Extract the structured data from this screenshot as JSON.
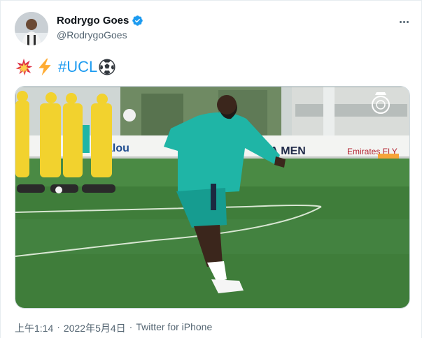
{
  "author": {
    "display_name": "Rodrygo Goes",
    "handle": "@RodrygoGoes",
    "verified": true,
    "avatar": "avatar-photo"
  },
  "tweet": {
    "emojis": [
      "collision-emoji",
      "high-voltage-emoji"
    ],
    "hashtag": "#UCL",
    "trailing_emoji": "soccer-ball-emoji"
  },
  "media": {
    "type": "video",
    "banner_texts": [
      "alou",
      "FA MEN",
      "Emirates FLY"
    ]
  },
  "meta": {
    "time": "上午1:14",
    "separator1": "·",
    "date": "2022年5月4日",
    "separator2": "·",
    "source": "Twitter for iPhone"
  },
  "colors": {
    "link": "#1d9bf0",
    "secondary_text": "#536471",
    "jersey": "#1fb5a6",
    "grass": "#3e7d3a",
    "dummy": "#f2d22e"
  },
  "more_icon": "more-horizontal-icon"
}
